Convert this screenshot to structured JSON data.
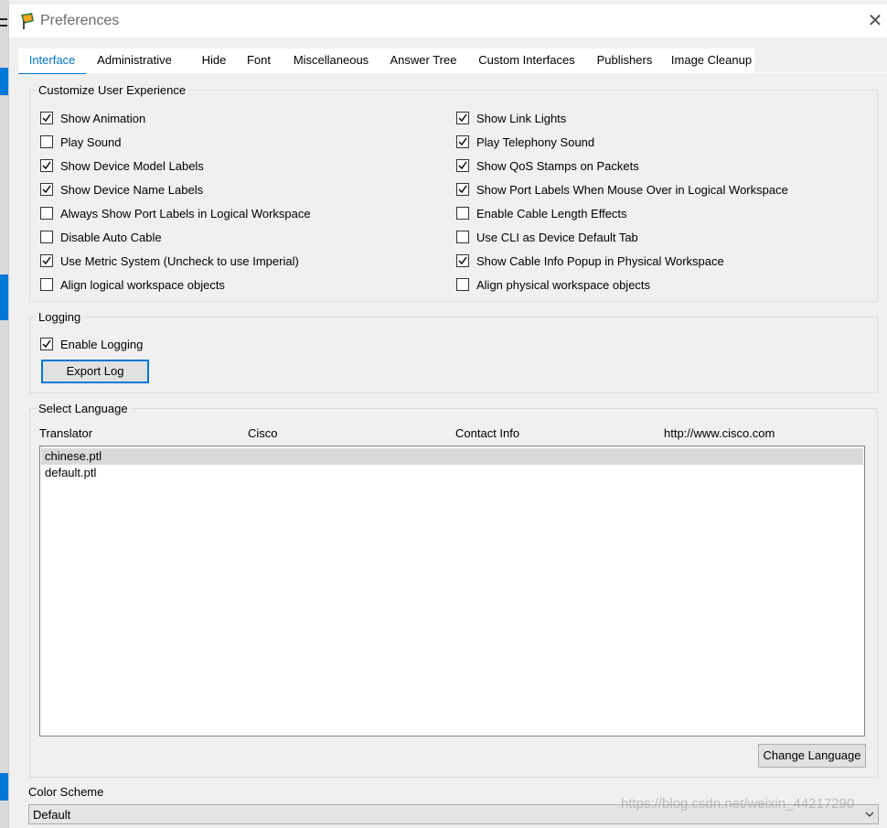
{
  "window": {
    "title": "Preferences"
  },
  "tabs": [
    {
      "label": "Interface",
      "active": true
    },
    {
      "label": "Administrative"
    },
    {
      "label": "Hide"
    },
    {
      "label": "Font"
    },
    {
      "label": "Miscellaneous"
    },
    {
      "label": "Answer Tree"
    },
    {
      "label": "Custom Interfaces"
    },
    {
      "label": "Publishers"
    },
    {
      "label": "Image Cleanup"
    }
  ],
  "customize": {
    "title": "Customize User Experience",
    "left": [
      {
        "label": "Show Animation",
        "checked": true
      },
      {
        "label": "Play Sound",
        "checked": false
      },
      {
        "label": "Show Device Model Labels",
        "checked": true
      },
      {
        "label": "Show Device Name Labels",
        "checked": true
      },
      {
        "label": "Always Show Port Labels in Logical Workspace",
        "checked": false
      },
      {
        "label": "Disable Auto Cable",
        "checked": false
      },
      {
        "label": "Use Metric System (Uncheck to use Imperial)",
        "checked": true
      },
      {
        "label": "Align logical workspace objects",
        "checked": false
      }
    ],
    "right": [
      {
        "label": "Show Link Lights",
        "checked": true
      },
      {
        "label": "Play Telephony Sound",
        "checked": true
      },
      {
        "label": "Show QoS Stamps on Packets",
        "checked": true
      },
      {
        "label": "Show Port Labels When Mouse Over in Logical Workspace",
        "checked": true
      },
      {
        "label": "Enable Cable Length Effects",
        "checked": false
      },
      {
        "label": "Use CLI as Device Default Tab",
        "checked": false
      },
      {
        "label": "Show Cable Info Popup in Physical Workspace",
        "checked": true
      },
      {
        "label": "Align physical workspace objects",
        "checked": false
      }
    ]
  },
  "logging": {
    "title": "Logging",
    "enable_label": "Enable Logging",
    "enable_checked": true,
    "export_label": "Export Log"
  },
  "language": {
    "title": "Select Language",
    "headers": [
      "Translator",
      "Cisco",
      "Contact Info",
      "http://www.cisco.com"
    ],
    "items": [
      {
        "label": "chinese.ptl",
        "selected": true
      },
      {
        "label": "default.ptl",
        "selected": false
      }
    ],
    "change_label": "Change Language"
  },
  "color_scheme": {
    "label": "Color Scheme",
    "value": "Default"
  },
  "watermark": "https://blog.csdn.net/weixin_44217290",
  "colors": {
    "accent": "#0078d7",
    "background": "#f0f0f0",
    "selected_row": "#d9d9d9"
  },
  "icons": {
    "app": "packet-tracer-icon",
    "close": "close-icon",
    "check": "checkmark-icon",
    "dropdown": "chevron-down-icon"
  }
}
